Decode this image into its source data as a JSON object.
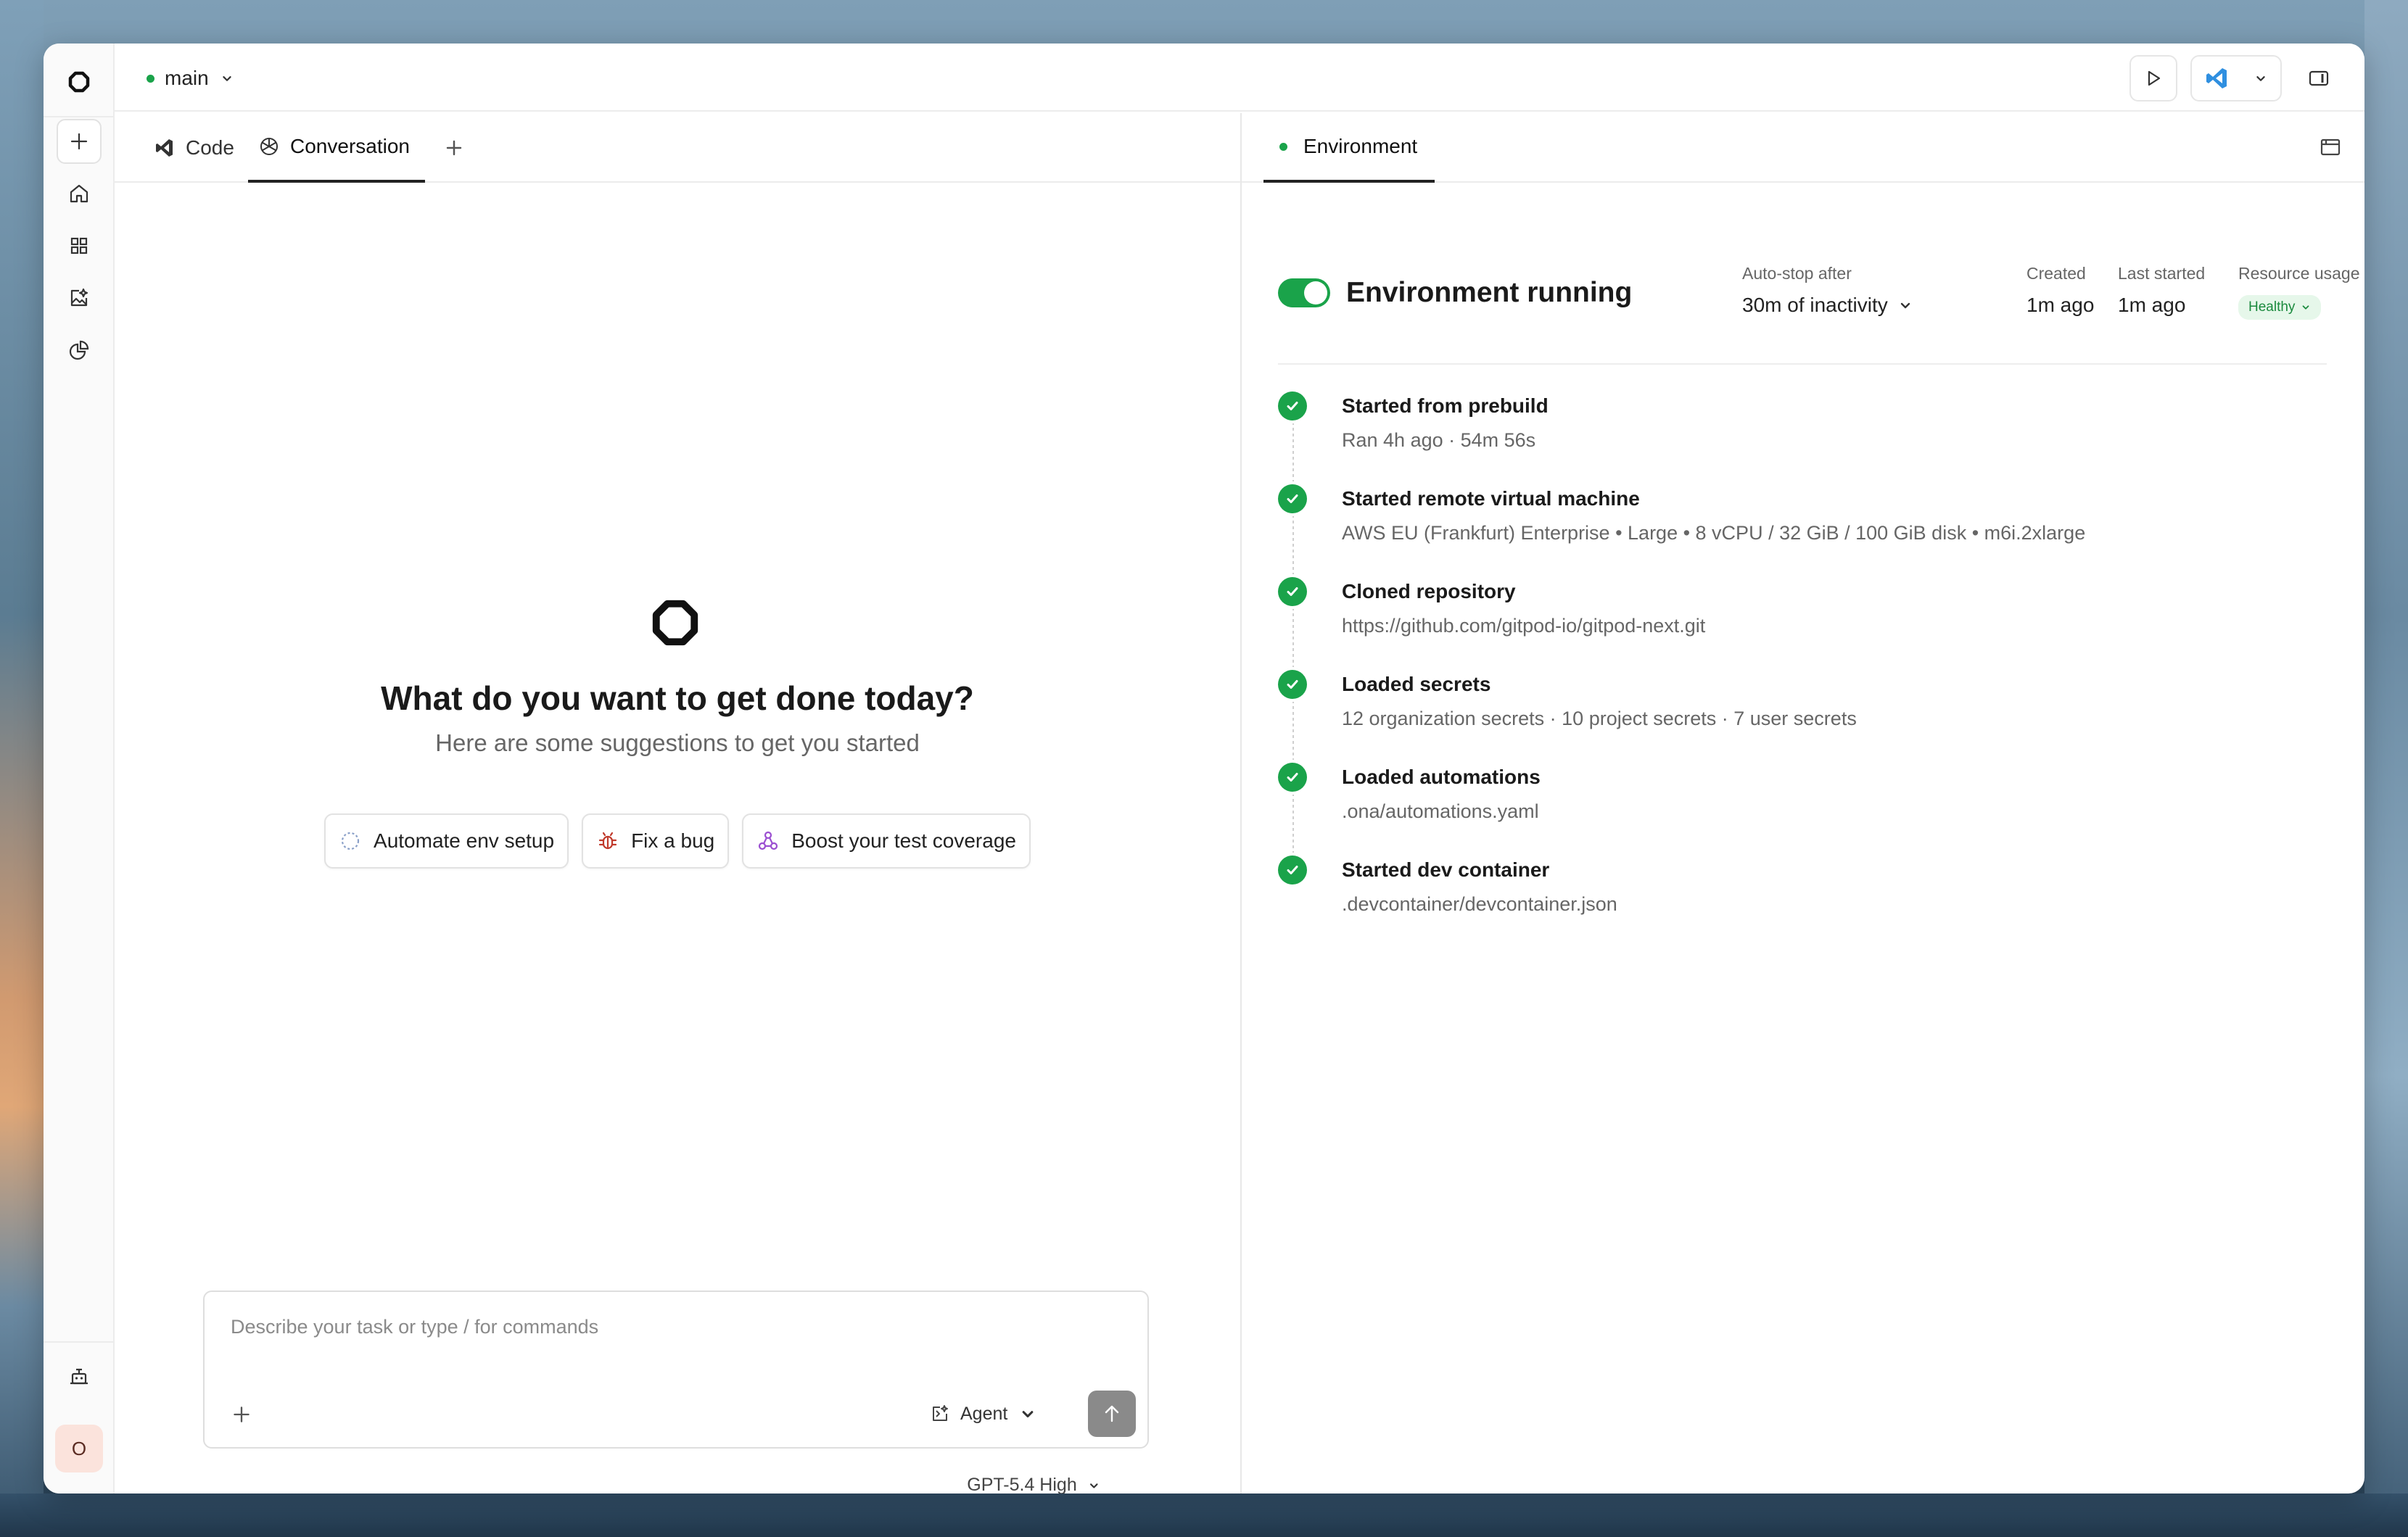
{
  "header": {
    "branch": "main"
  },
  "tabs": {
    "code": "Code",
    "conversation": "Conversation"
  },
  "hero": {
    "title": "What do you want to get done today?",
    "subtitle": "Here are some suggestions to get you started"
  },
  "suggestions": [
    {
      "label": "Automate env setup",
      "icon": "dashed-circle-icon"
    },
    {
      "label": "Fix a bug",
      "icon": "bug-icon"
    },
    {
      "label": "Boost your test coverage",
      "icon": "molecule-icon"
    }
  ],
  "composer": {
    "placeholder": "Describe your task or type / for commands",
    "mode": "Agent",
    "model": "GPT-5.4 High"
  },
  "right_panel": {
    "tab": "Environment",
    "status": "Environment running",
    "autostop_label": "Auto-stop after",
    "autostop_value": "30m of inactivity",
    "created_label": "Created",
    "created_value": "1m ago",
    "last_started_label": "Last started",
    "last_started_value": "1m ago",
    "resource_label": "Resource usage",
    "resource_value": "Healthy"
  },
  "steps": [
    {
      "title": "Started from prebuild",
      "detail": "Ran 4h ago · 54m 56s"
    },
    {
      "title": "Started remote virtual machine",
      "detail": "AWS EU (Frankfurt) Enterprise  •  Large  •  8 vCPU / 32 GiB / 100 GiB disk • m6i.2xlarge"
    },
    {
      "title": "Cloned repository",
      "detail": "https://github.com/gitpod-io/gitpod-next.git"
    },
    {
      "title": "Loaded secrets",
      "detail": "12 organization secrets · 10 project secrets · 7 user secrets"
    },
    {
      "title": "Loaded automations",
      "detail": ".ona/automations.yaml"
    },
    {
      "title": "Started dev container",
      "detail": ".devcontainer/devcontainer.json"
    }
  ],
  "user": {
    "avatar_initial": "O"
  },
  "colors": {
    "accent_green": "#1aa34a",
    "badge_bg": "#e6f7ea"
  }
}
